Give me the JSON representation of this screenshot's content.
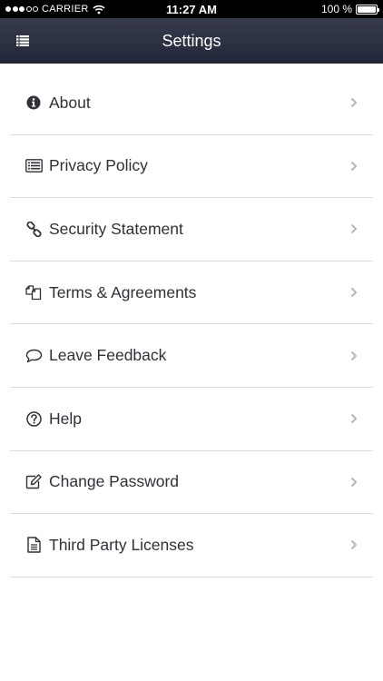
{
  "status_bar": {
    "carrier": "CARRIER",
    "time": "11:27 AM",
    "battery": "100 %",
    "signal_icon": "signal-dots-icon",
    "wifi_icon": "wifi-icon",
    "battery_icon": "battery-icon",
    "battery_level": 1.0
  },
  "nav": {
    "title": "Settings",
    "menu_icon": "list-menu-icon"
  },
  "colors": {
    "nav_background": "#2a2e40",
    "text": "#2f3138",
    "divider": "#dcdcdc",
    "chevron": "#b5b7bd"
  },
  "items": [
    {
      "label": "About",
      "icon": "info-circle-icon"
    },
    {
      "label": "Privacy Policy",
      "icon": "list-card-icon"
    },
    {
      "label": "Security Statement",
      "icon": "chain-link-icon"
    },
    {
      "label": "Terms & Agreements",
      "icon": "documents-icon"
    },
    {
      "label": "Leave Feedback",
      "icon": "speech-bubble-icon"
    },
    {
      "label": "Help",
      "icon": "question-circle-icon"
    },
    {
      "label": "Change Password",
      "icon": "edit-icon"
    },
    {
      "label": "Third Party Licenses",
      "icon": "document-icon"
    }
  ]
}
